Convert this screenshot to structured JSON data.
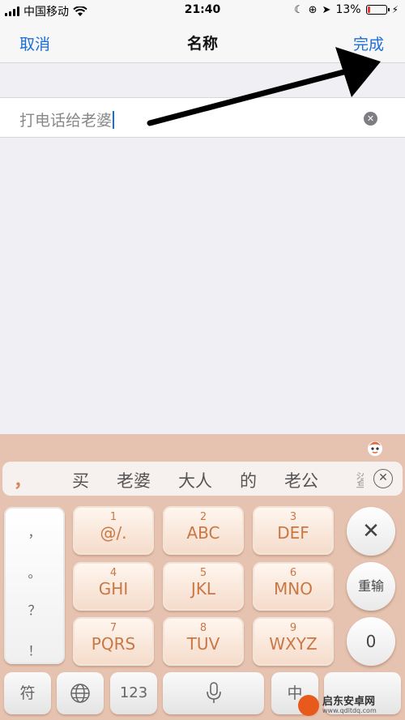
{
  "status_bar": {
    "carrier": "中国移动",
    "time": "21:40",
    "battery_percent": "13%",
    "battery_level": 0.13,
    "battery_color": "#e53935"
  },
  "nav": {
    "cancel_label": "取消",
    "title": "名称",
    "done_label": "完成"
  },
  "name_field": {
    "value": "打电话给老婆"
  },
  "keyboard": {
    "candidates": {
      "comma": "，",
      "words": [
        "买",
        "老婆",
        "大人",
        "的",
        "老公"
      ],
      "partial": "鲨"
    },
    "punctuation": [
      "，",
      "。",
      "？",
      "！"
    ],
    "keys": [
      {
        "num": "1",
        "letters": "@/."
      },
      {
        "num": "2",
        "letters": "ABC"
      },
      {
        "num": "3",
        "letters": "DEF"
      },
      {
        "num": "4",
        "letters": "GHI"
      },
      {
        "num": "5",
        "letters": "JKL"
      },
      {
        "num": "6",
        "letters": "MNO"
      },
      {
        "num": "7",
        "letters": "PQRS"
      },
      {
        "num": "8",
        "letters": "TUV"
      },
      {
        "num": "9",
        "letters": "WXYZ"
      }
    ],
    "delete_symbol": "✕",
    "retype_label": "重输",
    "zero_label": "0",
    "bottom_row": {
      "symbol_label": "符",
      "numbers_label": "123",
      "chinese_label": "中"
    },
    "accent_color": "#c97845"
  },
  "watermark": {
    "name": "启东安卓网",
    "url": "www.qdltdq.com"
  }
}
